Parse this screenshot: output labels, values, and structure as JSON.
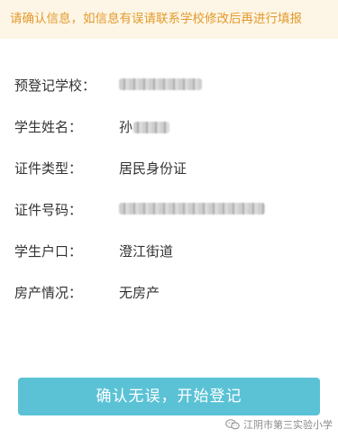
{
  "notice": {
    "text": "请确认信息，如信息有误请联系学校修改后再进行填报",
    "color": "#e39a2d",
    "background": "#fdf6e6"
  },
  "form": {
    "rows": [
      {
        "label": "预登记学校：",
        "value": "",
        "masked": true
      },
      {
        "label": "学生姓名：",
        "value": "孙",
        "masked": "partial"
      },
      {
        "label": "证件类型：",
        "value": "居民身份证"
      },
      {
        "label": "证件号码：",
        "value": "",
        "masked": true
      },
      {
        "label": "学生户口：",
        "value": "澄江街道"
      },
      {
        "label": "房产情况：",
        "value": "无房产"
      }
    ]
  },
  "actions": {
    "confirm_label": "确认无误，开始登记",
    "confirm_color": "#5bc2d6"
  },
  "watermark": {
    "text": "江阴市第三实验小学",
    "icon": "wechat-icon"
  }
}
